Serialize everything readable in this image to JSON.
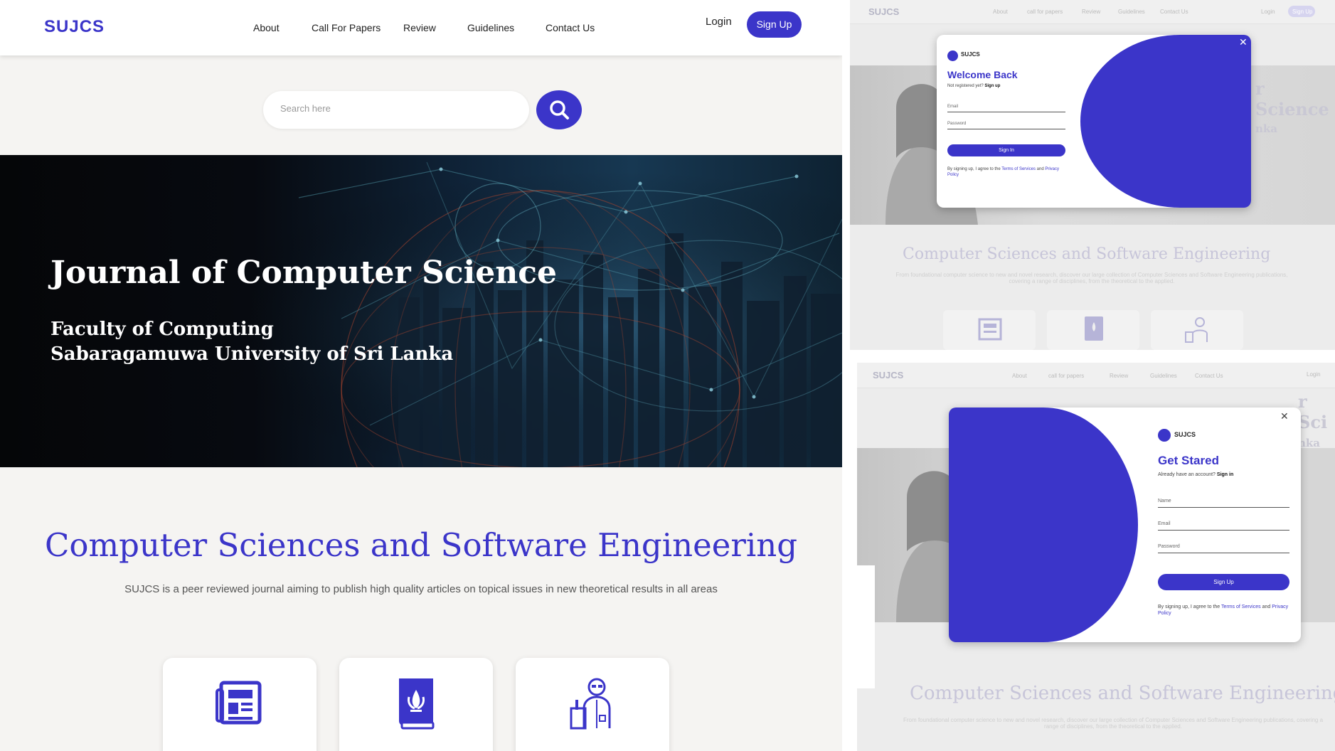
{
  "nav": {
    "logo": "SUJCS",
    "links": [
      "About",
      "Call For Papers",
      "Review",
      "Guidelines",
      "Contact Us"
    ],
    "login": "Login",
    "signup": "Sign Up"
  },
  "search": {
    "placeholder": "Search here"
  },
  "hero": {
    "title": "Journal of Computer Science",
    "subtitle_1": "Faculty of Computing",
    "subtitle_2": "Sabaragamuwa University of Sri Lanka"
  },
  "section": {
    "title": "Computer Sciences and Software Engineering",
    "description": "SUJCS is a peer reviewed journal aiming to publish high quality articles on topical issues in new theoretical results in all areas"
  },
  "cards": [
    {
      "icon": "newspaper-icon"
    },
    {
      "icon": "journal-book-icon"
    },
    {
      "icon": "researcher-icon"
    }
  ],
  "signin_modal": {
    "logo": "SUJCS",
    "title": "Welcome Back",
    "prompt": "Not registered yet?",
    "prompt_link": "Sign up",
    "email_label": "Email",
    "password_label": "Password",
    "button": "Sign In",
    "terms_prefix": "By signing up, I agree to the",
    "terms_link": "Terms of Services",
    "terms_and": "and",
    "privacy_link": "Privacy Policy",
    "close": "✕"
  },
  "signup_modal": {
    "logo": "SUJCS",
    "title": "Get Stared",
    "prompt": "Already have an account?",
    "prompt_link": "Sign in",
    "name_label": "Name",
    "email_label": "Email",
    "password_label": "Password",
    "button": "Sign Up",
    "terms_prefix": "By signing up, I agree to the",
    "terms_link": "Terms of Services",
    "terms_and": "and",
    "privacy_link": "Privacy Policy",
    "close": "✕"
  },
  "background_page": {
    "logo": "SUJCS",
    "links_top": [
      "About",
      "call for papers",
      "Review",
      "Guidelines",
      "Contact Us"
    ],
    "links_bottom": [
      "About",
      "call for papers",
      "Review",
      "Guidelines",
      "Contact Us"
    ],
    "login": "Login",
    "signup": "Sign Up",
    "title": "Computer Sciences and Software Engineering",
    "hero_fragment_1": "r Science",
    "hero_fragment_2": "nka",
    "hero_fragment_3": "r Sci",
    "hero_fragment_4": "nka",
    "description": "From foundational computer science to new and novel research, discover our large collection of Computer Sciences and Software Engineering publications, covering a range of disciplines, from the theoretical to the applied."
  },
  "colors": {
    "accent": "#3b35c9",
    "background": "#f5f4f2"
  }
}
